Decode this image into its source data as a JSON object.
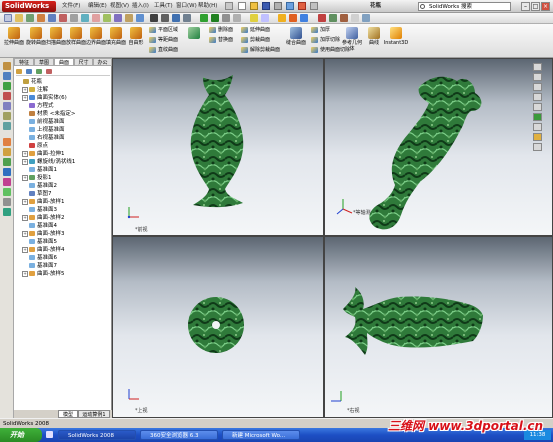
{
  "app": {
    "logo_text": "SolidWorks",
    "document_title": "花瓶",
    "search_placeholder": "SolidWorks 搜索",
    "menu": [
      "文件(F)",
      "编辑(E)",
      "视图(V)",
      "插入(I)",
      "工具(T)",
      "窗口(W)",
      "帮助(H)"
    ]
  },
  "ribbon": {
    "big_buttons": [
      "拉伸曲面",
      "旋转曲面",
      "扫描曲面",
      "放样曲面",
      "边界曲面",
      "填充曲面",
      "自由形",
      "平面区域",
      "等距曲面",
      "直纹曲面",
      "删除面",
      "替换面",
      "延伸曲面",
      "剪裁曲面",
      "解除剪裁曲面",
      "缝合曲面",
      "加厚",
      "参考几何体",
      "曲线",
      "Instant3D"
    ],
    "small_buttons": [
      "平面区域",
      "等距曲面",
      "直纹曲面",
      "删除面",
      "替换面",
      "延伸曲面",
      "剪裁曲面",
      "解除剪裁曲面",
      "缝合曲面",
      "加厚",
      "加厚切除",
      "使用曲面切除"
    ]
  },
  "feature_tree": {
    "tabs": [
      "特征",
      "草图",
      "曲面",
      "尺寸",
      "办公"
    ],
    "items": [
      {
        "label": "花瓶",
        "indent": 0,
        "expand": false,
        "color": "#c0a040"
      },
      {
        "label": "注解",
        "indent": 1,
        "expand": true,
        "color": "#d0b040"
      },
      {
        "label": "曲面实体(6)",
        "indent": 1,
        "expand": true,
        "color": "#4a8ad8"
      },
      {
        "label": "方程式",
        "indent": 1,
        "expand": false,
        "color": "#8a6ad0"
      },
      {
        "label": "材质 <未指定>",
        "indent": 1,
        "expand": false,
        "color": "#c08040"
      },
      {
        "label": "前视基准面",
        "indent": 1,
        "expand": false,
        "color": "#7ab0e0"
      },
      {
        "label": "上视基准面",
        "indent": 1,
        "expand": false,
        "color": "#7ab0e0"
      },
      {
        "label": "右视基准面",
        "indent": 1,
        "expand": false,
        "color": "#7ab0e0"
      },
      {
        "label": "原点",
        "indent": 1,
        "expand": false,
        "color": "#d04040"
      },
      {
        "label": "曲面-拉伸1",
        "indent": 1,
        "expand": true,
        "color": "#e0a040"
      },
      {
        "label": "螺旋线/涡状线1",
        "indent": 1,
        "expand": true,
        "color": "#40a0c0"
      },
      {
        "label": "基准面1",
        "indent": 1,
        "expand": false,
        "color": "#7ab0e0"
      },
      {
        "label": "投影1",
        "indent": 1,
        "expand": true,
        "color": "#60a060"
      },
      {
        "label": "基准面2",
        "indent": 1,
        "expand": false,
        "color": "#7ab0e0"
      },
      {
        "label": "草图7",
        "indent": 1,
        "expand": false,
        "color": "#6080c0"
      },
      {
        "label": "曲面-放样1",
        "indent": 1,
        "expand": true,
        "color": "#e0a040"
      },
      {
        "label": "基准面3",
        "indent": 1,
        "expand": false,
        "color": "#7ab0e0"
      },
      {
        "label": "曲面-放样2",
        "indent": 1,
        "expand": true,
        "color": "#e0a040"
      },
      {
        "label": "基准面4",
        "indent": 1,
        "expand": false,
        "color": "#7ab0e0"
      },
      {
        "label": "曲面-放样3",
        "indent": 1,
        "expand": true,
        "color": "#e0a040"
      },
      {
        "label": "基准面5",
        "indent": 1,
        "expand": false,
        "color": "#7ab0e0"
      },
      {
        "label": "曲面-放样4",
        "indent": 1,
        "expand": true,
        "color": "#e0a040"
      },
      {
        "label": "基准面6",
        "indent": 1,
        "expand": false,
        "color": "#7ab0e0"
      },
      {
        "label": "基准面7",
        "indent": 1,
        "expand": false,
        "color": "#7ab0e0"
      },
      {
        "label": "曲面-放样5",
        "indent": 1,
        "expand": true,
        "color": "#e0a040"
      }
    ]
  },
  "bottom_tabs": [
    "模型",
    "运动算例1"
  ],
  "viewports": {
    "top_left": "*前视",
    "top_right": "*等轴测",
    "bottom_left": "*上视",
    "bottom_right": "*右视"
  },
  "status_text": "SolidWorks 2008",
  "taskbar": {
    "start_label": "开始",
    "tasks": [
      "SolidWorks 2008",
      "360安全浏览器 6.3",
      "新建 Microsoft Wo..."
    ],
    "clock": "11:38"
  },
  "watermark": "三维网 www.3dportal.cn",
  "colors": {
    "model_green": "#2f7a3a",
    "model_dark": "#0f3a18",
    "model_light": "#7ed08a",
    "viewport_top": "#5c6672",
    "viewport_bottom": "#f4f6f8"
  }
}
